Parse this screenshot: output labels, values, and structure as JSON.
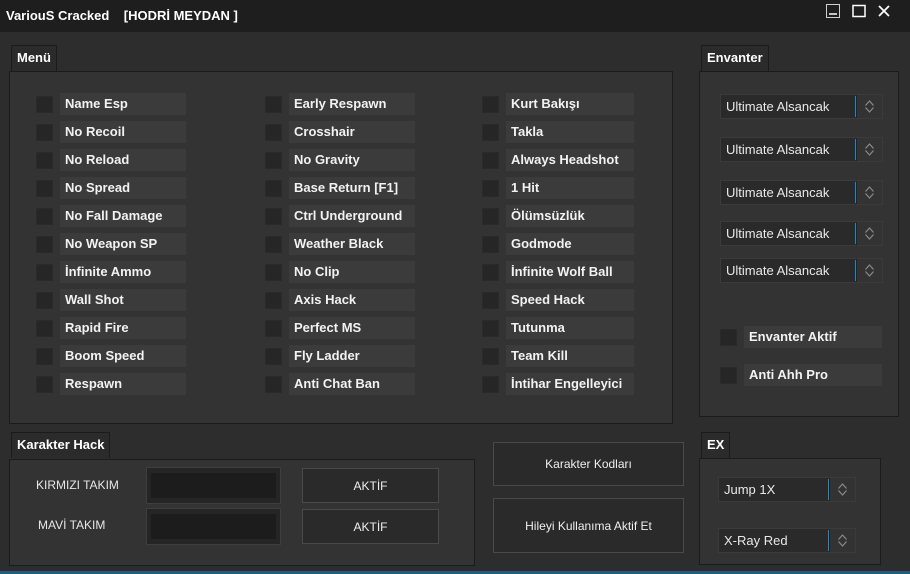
{
  "window": {
    "title": "VariouS Cracked    [HODRİ MEYDAN ]"
  },
  "menu": {
    "label": "Menü",
    "columns": [
      [
        "Name Esp",
        "No Recoil",
        "No Reload",
        "No Spread",
        "No Fall Damage",
        "No Weapon SP",
        "İnfinite Ammo",
        "Wall Shot",
        "Rapid Fire",
        "Boom Speed",
        "Respawn"
      ],
      [
        "Early Respawn",
        "Crosshair",
        "No Gravity",
        "Base Return  [F1]",
        "Ctrl Underground",
        "Weather Black",
        "No Clip",
        "Axis Hack",
        "Perfect MS",
        "Fly Ladder",
        "Anti Chat Ban"
      ],
      [
        "Kurt Bakışı",
        "Takla",
        "Always Headshot",
        "1 Hit",
        "Ölümsüzlük",
        "Godmode",
        "İnfinite Wolf Ball",
        "Speed Hack",
        "Tutunma",
        "Team Kill",
        "İntihar Engelleyici"
      ]
    ]
  },
  "envanter": {
    "label": "Envanter",
    "combos": [
      "Ultimate Alsancak",
      "Ultimate Alsancak",
      "Ultimate Alsancak",
      "Ultimate Alsancak",
      "Ultimate Alsancak"
    ],
    "aktif_label": "Envanter Aktif",
    "anti_ahh_label": "Anti Ahh Pro"
  },
  "karakter": {
    "label": "Karakter Hack",
    "red_label": "KIRMIZI TAKIM",
    "blue_label": "MAVİ TAKIM",
    "red_button": "AKTİF",
    "blue_button": "AKTİF"
  },
  "actions": {
    "codes_button": "Karakter Kodları",
    "activate_button": "Hileyi Kullanıma Aktif Et"
  },
  "ex": {
    "label": "EX",
    "combos": [
      "Jump 1X",
      "X-Ray Red"
    ]
  },
  "colors": {
    "accent": "#1e88c8",
    "background": "#2d2d2d",
    "titlebar": "#1e1e1e"
  }
}
